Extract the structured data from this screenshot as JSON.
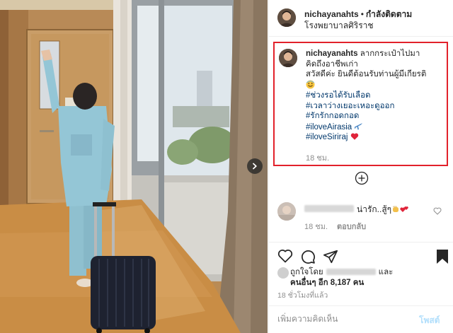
{
  "post": {
    "username": "nichayanahts",
    "separator": "•",
    "follow_status": "กำลังติดตาม",
    "location": "โรงพยาบาลศิริราช"
  },
  "caption": {
    "username": "nichayanahts",
    "lines": [
      "ลากกระเป๋าไปมา",
      "คิดถึงอาชีพเก่า",
      "สวัสดีค่ะ ยินดีต้อนรับท่านผู้มีเกียรติ"
    ],
    "hashtags": [
      "#ช่วงรอได้รับเลือด",
      "#เวลาว่างเยอะเหอะดูออก",
      "#รักรักกอดกอด",
      "#iloveAirasia",
      "#iloveSiriraj"
    ],
    "time": "18 ชม."
  },
  "comment": {
    "text": "น่ารัก..สู้ๆ",
    "time": "18 ชม.",
    "reply_label": "ตอบกลับ"
  },
  "likes": {
    "prefix": "ถูกใจโดย",
    "and": "และ",
    "others": "คนอื่นๆ อีก 8,187 คน",
    "time": "18 ชั่วโมงที่แล้ว"
  },
  "add_comment": {
    "placeholder": "เพิ่มความคิดเห็น",
    "post_label": "โพสต์"
  },
  "colors": {
    "highlight_border": "#e2212b",
    "hashtag": "#00376b",
    "muted": "#8e8e8e",
    "post_button": "#b2dffc"
  },
  "icons": [
    "chevron-right-icon",
    "plus-circle-icon",
    "heart-icon",
    "comment-icon",
    "share-icon",
    "bookmark-icon",
    "avatar-icon"
  ]
}
